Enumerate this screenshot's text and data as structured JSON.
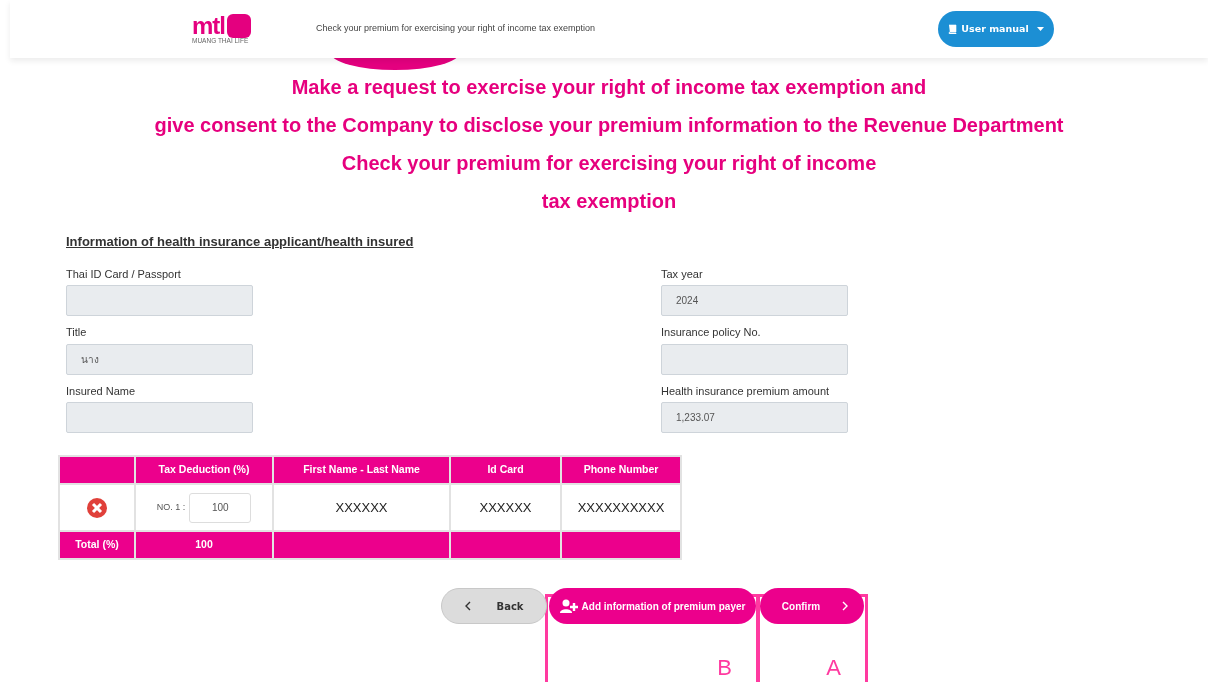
{
  "header": {
    "logo_text": "mtl",
    "logo_subtext": "MUANG THAI LIFE",
    "page_title": "Check your premium for exercising your right of income tax exemption",
    "user_manual_button": "User manual"
  },
  "title_lines": [
    "Make a request to exercise your right of income tax exemption and",
    "give consent to the Company to disclose your premium information to the Revenue Department",
    "Check your premium for exercising your right of income",
    "tax exemption"
  ],
  "section_heading": "Information of health insurance applicant/health insured",
  "fields_left": [
    {
      "label": "Thai ID Card / Passport"
    },
    {
      "label": "Title",
      "value": "นาง"
    },
    {
      "label": "Insured Name"
    }
  ],
  "fields_right": [
    {
      "label": "Tax year",
      "value": "2024"
    },
    {
      "label": "Insurance policy No."
    },
    {
      "label": "Health insurance premium amount",
      "value": "1,233.07"
    }
  ],
  "table": {
    "columns": [
      "",
      "Tax Deduction (%)",
      "First Name - Last Name",
      "Id Card",
      "Phone Number"
    ],
    "rows": [
      {
        "number_label": "NO. 1 :",
        "deduction": "100",
        "name": "XXXXXX",
        "id_card": "XXXXXX",
        "phone": "XXXXXXXXXX"
      }
    ],
    "total_label": "Total (%)",
    "total_value": "100"
  },
  "buttons": {
    "back": "Back",
    "add": "Add information of premium payer",
    "confirm": "Confirm"
  },
  "callouts": [
    {
      "label": "B"
    },
    {
      "label": "A"
    }
  ]
}
